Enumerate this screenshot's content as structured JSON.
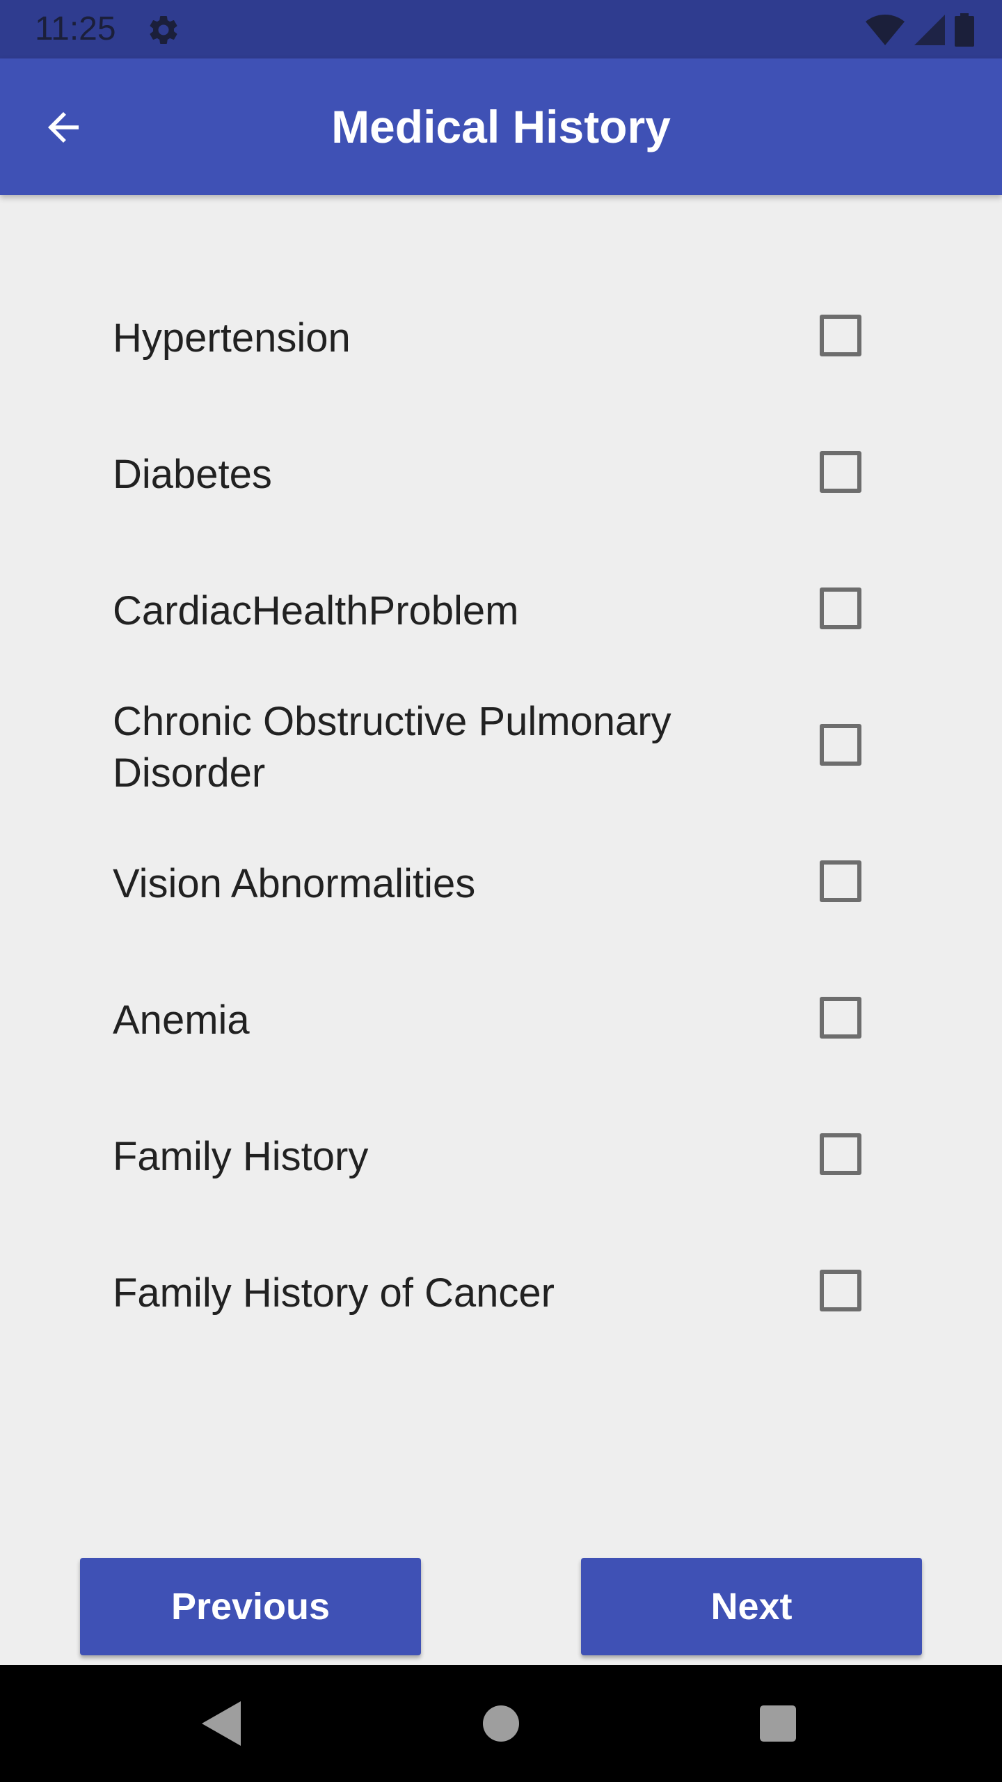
{
  "status_bar": {
    "time": "11:25",
    "icons": [
      "gear-icon",
      "wifi-icon",
      "signal-icon",
      "battery-icon"
    ]
  },
  "app_bar": {
    "title": "Medical History",
    "back_icon": "arrow-back-icon"
  },
  "conditions": [
    {
      "label": "Hypertension",
      "checked": false
    },
    {
      "label": "Diabetes",
      "checked": false
    },
    {
      "label": "CardiacHealthProblem",
      "checked": false
    },
    {
      "label": "Chronic Obstructive Pulmonary Disorder",
      "checked": false
    },
    {
      "label": "Vision Abnormalities",
      "checked": false
    },
    {
      "label": "Anemia",
      "checked": false
    },
    {
      "label": "Family History",
      "checked": false
    },
    {
      "label": "Family History of Cancer",
      "checked": false
    }
  ],
  "buttons": {
    "previous": "Previous",
    "next": "Next"
  },
  "colors": {
    "app_bar": "#3f51b5",
    "status_bar": "#2f3c8f",
    "button": "#3f51b5",
    "background": "#eeeeee"
  }
}
